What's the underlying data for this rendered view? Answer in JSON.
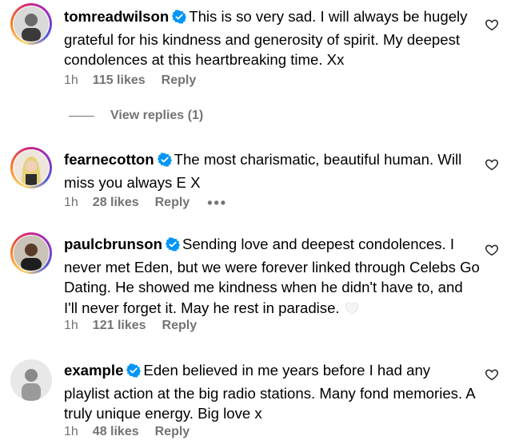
{
  "comments": [
    {
      "username": "tomreadwilson",
      "text": "This is so very sad. I will always be hugely grateful for his kindness and generosity of spirit. My deepest condolences at this heartbreaking time. Xx",
      "time": "1h",
      "likes": "115 likes",
      "reply": "Reply",
      "avatar_ring": true
    },
    {
      "username": "fearnecotton",
      "text": "The most charismatic, beautiful human. Will miss you always E X",
      "time": "1h",
      "likes": "28 likes",
      "reply": "Reply",
      "more": "•••",
      "avatar_ring": true
    },
    {
      "username": "paulcbrunson",
      "text": "Sending love and deepest condolences. I never met Eden, but we were forever linked through Celebs Go Dating. He showed me kindness when he didn't have to, and I'll never forget it. May he rest in paradise.",
      "emoji": "white-heart",
      "time": "1h",
      "likes": "121 likes",
      "reply": "Reply",
      "avatar_ring": true
    },
    {
      "username": "example",
      "text": "Eden believed in me years before I had any playlist action at the big radio stations. Many fond memories. A truly unique energy. Big love x",
      "time": "1h",
      "likes": "48 likes",
      "reply": "Reply",
      "avatar_ring": false
    }
  ],
  "view_replies": "View replies (1)",
  "colors": {
    "verified": "#0095f6",
    "meta": "#737373",
    "text": "#000000"
  },
  "icons": {
    "like": "heart-outline-icon",
    "verified": "verified-badge-icon"
  }
}
